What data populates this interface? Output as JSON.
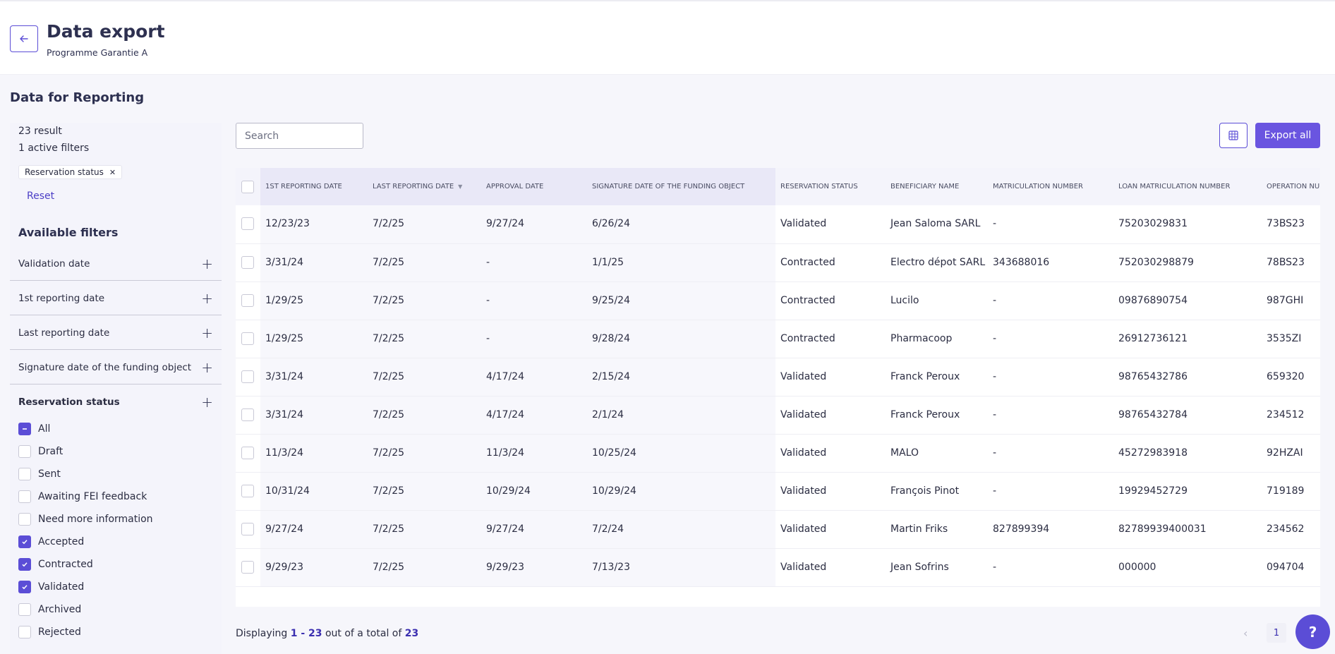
{
  "header": {
    "title": "Data export",
    "subtitle": "Programme Garantie A",
    "back_icon": "arrow-left-icon"
  },
  "section_title": "Data for Reporting",
  "sidebar": {
    "result_count": "23 result",
    "active_filters": "1 active filters",
    "chip_label": "Reservation status",
    "reset": "Reset",
    "available_title": "Available filters",
    "filters": [
      "Validation date",
      "1st reporting date",
      "Last reporting date",
      "Signature date of the funding object",
      "Reservation status"
    ],
    "status_options": [
      {
        "label": "All",
        "state": "indeterminate"
      },
      {
        "label": "Draft",
        "state": "unchecked"
      },
      {
        "label": "Sent",
        "state": "unchecked"
      },
      {
        "label": "Awaiting FEI feedback",
        "state": "unchecked"
      },
      {
        "label": "Need more information",
        "state": "unchecked"
      },
      {
        "label": "Accepted",
        "state": "checked"
      },
      {
        "label": "Contracted",
        "state": "checked"
      },
      {
        "label": "Validated",
        "state": "checked"
      },
      {
        "label": "Archived",
        "state": "unchecked"
      },
      {
        "label": "Rejected",
        "state": "unchecked"
      }
    ]
  },
  "toolbar": {
    "search_placeholder": "Search",
    "grid_icon": "table-grid-icon",
    "export_all": "Export all"
  },
  "table": {
    "columns": [
      "1st reporting date",
      "Last reporting date",
      "Approval date",
      "Signature date of the funding object",
      "Reservation status",
      "Beneficiary name",
      "Matriculation number",
      "Loan matriculation number",
      "Operation number"
    ],
    "rows": [
      [
        "12/23/23",
        "7/2/25",
        "9/27/24",
        "6/26/24",
        "Validated",
        "Jean Saloma SARL",
        "-",
        "75203029831",
        "73BS23"
      ],
      [
        "3/31/24",
        "7/2/25",
        "-",
        "1/1/25",
        "Contracted",
        "Electro dépot SARL",
        "343688016",
        "752030298879",
        "78BS23"
      ],
      [
        "1/29/25",
        "7/2/25",
        "-",
        "9/25/24",
        "Contracted",
        "Lucilo",
        "-",
        "09876890754",
        "987GHI"
      ],
      [
        "1/29/25",
        "7/2/25",
        "-",
        "9/28/24",
        "Contracted",
        "Pharmacoop",
        "-",
        "26912736121",
        "3535ZI"
      ],
      [
        "3/31/24",
        "7/2/25",
        "4/17/24",
        "2/15/24",
        "Validated",
        "Franck Peroux",
        "-",
        "98765432786",
        "659320"
      ],
      [
        "3/31/24",
        "7/2/25",
        "4/17/24",
        "2/1/24",
        "Validated",
        "Franck Peroux",
        "-",
        "98765432784",
        "234512"
      ],
      [
        "11/3/24",
        "7/2/25",
        "11/3/24",
        "10/25/24",
        "Validated",
        "MALO",
        "-",
        "45272983918",
        "92HZAI"
      ],
      [
        "10/31/24",
        "7/2/25",
        "10/29/24",
        "10/29/24",
        "Validated",
        "François Pinot",
        "-",
        "19929452729",
        "719189"
      ],
      [
        "9/27/24",
        "7/2/25",
        "9/27/24",
        "7/2/24",
        "Validated",
        "Martin Friks",
        "827899394",
        "82789939400031",
        "234562"
      ],
      [
        "9/29/23",
        "7/2/25",
        "9/29/23",
        "7/13/23",
        "Validated",
        "Jean Sofrins",
        "-",
        "000000",
        "094704"
      ]
    ]
  },
  "footer": {
    "prefix": "Displaying",
    "range": "1 - 23",
    "middle": "out of a total of",
    "total": "23",
    "page": "1"
  },
  "help": "?",
  "colors": {
    "accent": "#5b4dd6",
    "accent_dark": "#3b2fb0",
    "export_button": "#6a55e0"
  }
}
